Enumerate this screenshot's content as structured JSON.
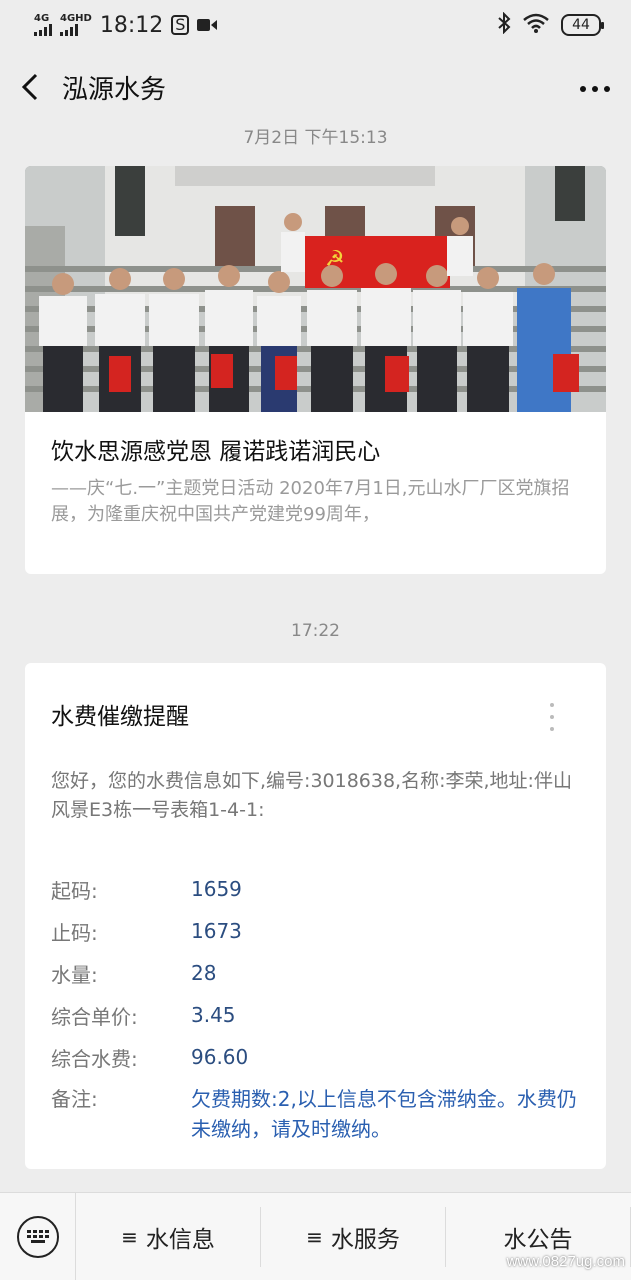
{
  "status_bar": {
    "network1": "4G",
    "network2": "4GHD",
    "time": "18:12",
    "battery": "44"
  },
  "nav": {
    "title": "泓源水务"
  },
  "messages": [
    {
      "timestamp": "7月2日 下午15:13",
      "article": {
        "title": "饮水思源感党恩  履诺践诺润民心",
        "description": "——庆“七.一”主题党日活动 2020年7月1日,元山水厂厂区党旗招展，为隆重庆祝中国共产党建党99周年，"
      }
    },
    {
      "timestamp": "17:22",
      "bill": {
        "title": "水费催缴提醒",
        "intro": "您好，您的水费信息如下,编号:3018638,名称:李荣,地址:伴山风景E3栋一号表箱1-4-1:",
        "rows": [
          {
            "label": "起码:",
            "value": "1659"
          },
          {
            "label": "止码:",
            "value": "1673"
          },
          {
            "label": "水量:",
            "value": "28"
          },
          {
            "label": "综合单价:",
            "value": "3.45"
          },
          {
            "label": "综合水费:",
            "value": "96.60"
          }
        ],
        "remark_label": "备注:",
        "remark_value": "欠费期数:2,以上信息不包含滞纳金。水费仍未缴纳，请及时缴纳。"
      }
    }
  ],
  "bottom_menu": {
    "items": [
      {
        "icon": "≡",
        "label": "水信息"
      },
      {
        "icon": "≡",
        "label": "水服务"
      },
      {
        "icon": "",
        "label": "水公告"
      }
    ],
    "watermark": "www.0827ug.com"
  }
}
